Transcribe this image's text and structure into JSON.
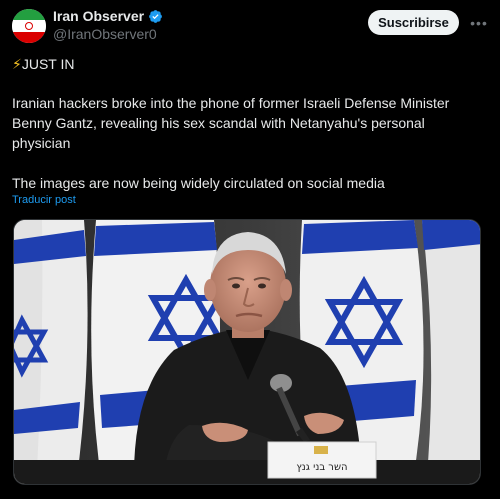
{
  "account": {
    "display_name": "Iran Observer",
    "handle": "@IranObserver0",
    "verified": true,
    "avatar_icon": "iran-flag-icon"
  },
  "actions": {
    "subscribe_label": "Suscribirse",
    "more_icon": "more-options-icon"
  },
  "post": {
    "headline_icon": "lightning-icon",
    "headline": "JUST IN",
    "body_lines": [
      "Iranian hackers broke into the phone of former Israeli Defense Minister",
      "Benny Gantz, revealing his sex scandal with Netanyahu's personal",
      "physician"
    ],
    "closing": "The images are now being widely circulated on social media",
    "translate_label": "Traducir post"
  },
  "media": {
    "nameplate_text": "השר בני גנץ"
  },
  "colors": {
    "background": "#000000",
    "text": "#e7e9ea",
    "muted": "#71767b",
    "link": "#1d9bf0",
    "verified": "#1d9bf0",
    "flag_blue": "#1f3fb0"
  }
}
